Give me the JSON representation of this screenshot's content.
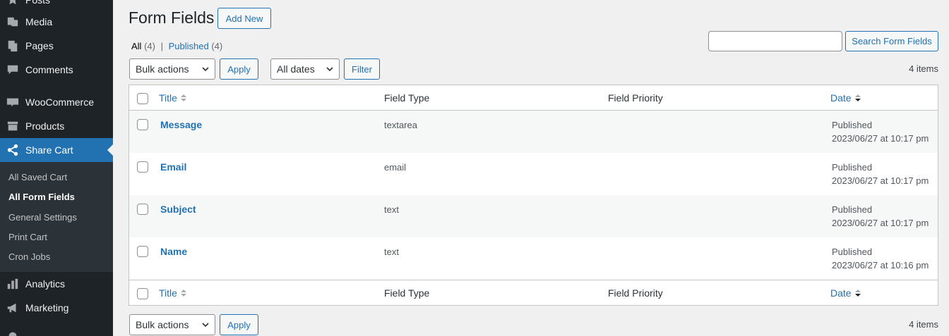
{
  "sidebar": {
    "items": [
      {
        "label": "Posts",
        "icon": "pin-icon"
      },
      {
        "label": "Media",
        "icon": "media-icon"
      },
      {
        "label": "Pages",
        "icon": "pages-icon"
      },
      {
        "label": "Comments",
        "icon": "comments-icon"
      },
      {
        "label": "WooCommerce",
        "icon": "woocommerce-icon"
      },
      {
        "label": "Products",
        "icon": "products-icon"
      },
      {
        "label": "Share Cart",
        "icon": "share-icon"
      },
      {
        "label": "Analytics",
        "icon": "analytics-icon"
      },
      {
        "label": "Marketing",
        "icon": "megaphone-icon"
      }
    ],
    "submenu": [
      {
        "label": "All Saved Cart"
      },
      {
        "label": "All Form Fields"
      },
      {
        "label": "General Settings"
      },
      {
        "label": "Print Cart"
      },
      {
        "label": "Cron Jobs"
      }
    ]
  },
  "header": {
    "title": "Form Fields",
    "add_new": "Add New"
  },
  "views": {
    "all_label": "All",
    "all_count": "(4)",
    "separator": "|",
    "published_label": "Published",
    "published_count": "(4)"
  },
  "search": {
    "placeholder": "",
    "button": "Search Form Fields"
  },
  "toolbar": {
    "bulk_actions": "Bulk actions",
    "apply": "Apply",
    "all_dates": "All dates",
    "filter": "Filter",
    "items_count": "4 items"
  },
  "table": {
    "columns": [
      "Title",
      "Field Type",
      "Field Priority",
      "Date"
    ],
    "rows": [
      {
        "title": "Message",
        "field_type": "textarea",
        "priority": "",
        "status": "Published",
        "date": "2023/06/27 at 10:17 pm"
      },
      {
        "title": "Email",
        "field_type": "email",
        "priority": "",
        "status": "Published",
        "date": "2023/06/27 at 10:17 pm"
      },
      {
        "title": "Subject",
        "field_type": "text",
        "priority": "",
        "status": "Published",
        "date": "2023/06/27 at 10:17 pm"
      },
      {
        "title": "Name",
        "field_type": "text",
        "priority": "",
        "status": "Published",
        "date": "2023/06/27 at 10:16 pm"
      }
    ]
  },
  "colors": {
    "sidebar_bg": "#1d2327",
    "accent": "#2271b1",
    "page_bg": "#f0f0f1"
  }
}
